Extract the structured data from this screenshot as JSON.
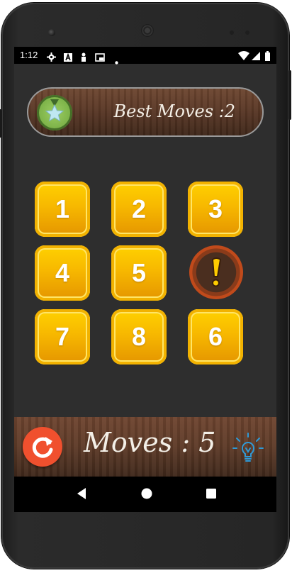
{
  "status_bar": {
    "time": "1:12",
    "icons": [
      "gear-icon",
      "a-icon",
      "figure-icon",
      "cast-icon",
      "dot-icon",
      "wifi-icon",
      "signal-icon",
      "battery-icon"
    ]
  },
  "header": {
    "best_moves": "Best Moves :2",
    "medal_icon": "medal-star-icon"
  },
  "grid": {
    "tiles": [
      {
        "label": "1"
      },
      {
        "label": "2"
      },
      {
        "label": "3"
      },
      {
        "label": "4"
      },
      {
        "label": "5"
      },
      {
        "label": "!"
      },
      {
        "label": "7"
      },
      {
        "label": "8"
      },
      {
        "label": "6"
      }
    ]
  },
  "footer": {
    "moves": "Moves : 5",
    "refresh_icon": "refresh-icon",
    "hint_icon": "lightbulb-icon"
  },
  "colors": {
    "tile": "#f7b800",
    "refresh": "#f0502e",
    "bulb": "#2e9ad8"
  }
}
